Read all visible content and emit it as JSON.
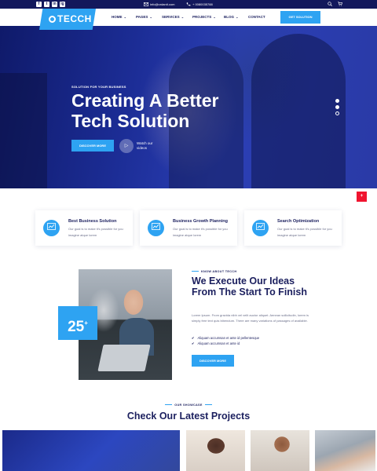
{
  "topbar": {
    "social": [
      "f",
      "t",
      "in",
      "ig"
    ],
    "email": "info@ordanit.com",
    "phone": "+ 0080035788",
    "tools": [
      "search-icon",
      "cart-icon"
    ]
  },
  "header": {
    "logo_text": "TECCH",
    "nav": [
      {
        "label": "HOME",
        "has_dropdown": true
      },
      {
        "label": "PAGES",
        "has_dropdown": true
      },
      {
        "label": "SERVICES",
        "has_dropdown": true
      },
      {
        "label": "PROJECTS",
        "has_dropdown": true
      },
      {
        "label": "BLOG",
        "has_dropdown": true
      },
      {
        "label": "CONTACT",
        "has_dropdown": false
      }
    ],
    "cta": "GET SOLUTION"
  },
  "hero": {
    "eyebrow": "SOLUTION FOR YOUR BUSINESS",
    "title_line1": "Creating A Better",
    "title_line2": "Tech Solution",
    "button": "DISCOVER MORE",
    "video_label": "Watch our videos",
    "slider_dots": 3,
    "active_dot": 3
  },
  "features": [
    {
      "title": "Best Business Solution",
      "text": "Our goal is to make it's possible for you imagine atque lorem",
      "icon": "chart-icon"
    },
    {
      "title": "Business Growth Planning",
      "text": "Our goal is to make it's possible for you imagine atque lorem",
      "icon": "chart-icon"
    },
    {
      "title": "Search Optimization",
      "text": "Our goal is to make it's possible for you imagine atque lorem",
      "icon": "chart-icon"
    }
  ],
  "about": {
    "eyebrow": "KNOW ABOUT TECCH",
    "title": "We Execute Our Ideas From The Start To Finish",
    "text": "Lorem Ipsum. From gravida nibh vel velit auctor aliquet. Aenean sollicitudin, lorem is simply free text quis bibendum. There are many variations of passages of available.",
    "checks": [
      "Aliquam accumsan et ante id pellentesque",
      "Aliquam accumsan et ante id"
    ],
    "button": "DISCOVER MORE",
    "badge_number": "25",
    "badge_suffix": "+"
  },
  "projects": {
    "eyebrow": "OUR SHOWCASE",
    "title": "Check Our Latest Projects"
  },
  "colors": {
    "navy": "#13185c",
    "accent": "#2ea3f2",
    "heading": "#1b1f5e",
    "scroll_button": "#f0142f"
  }
}
